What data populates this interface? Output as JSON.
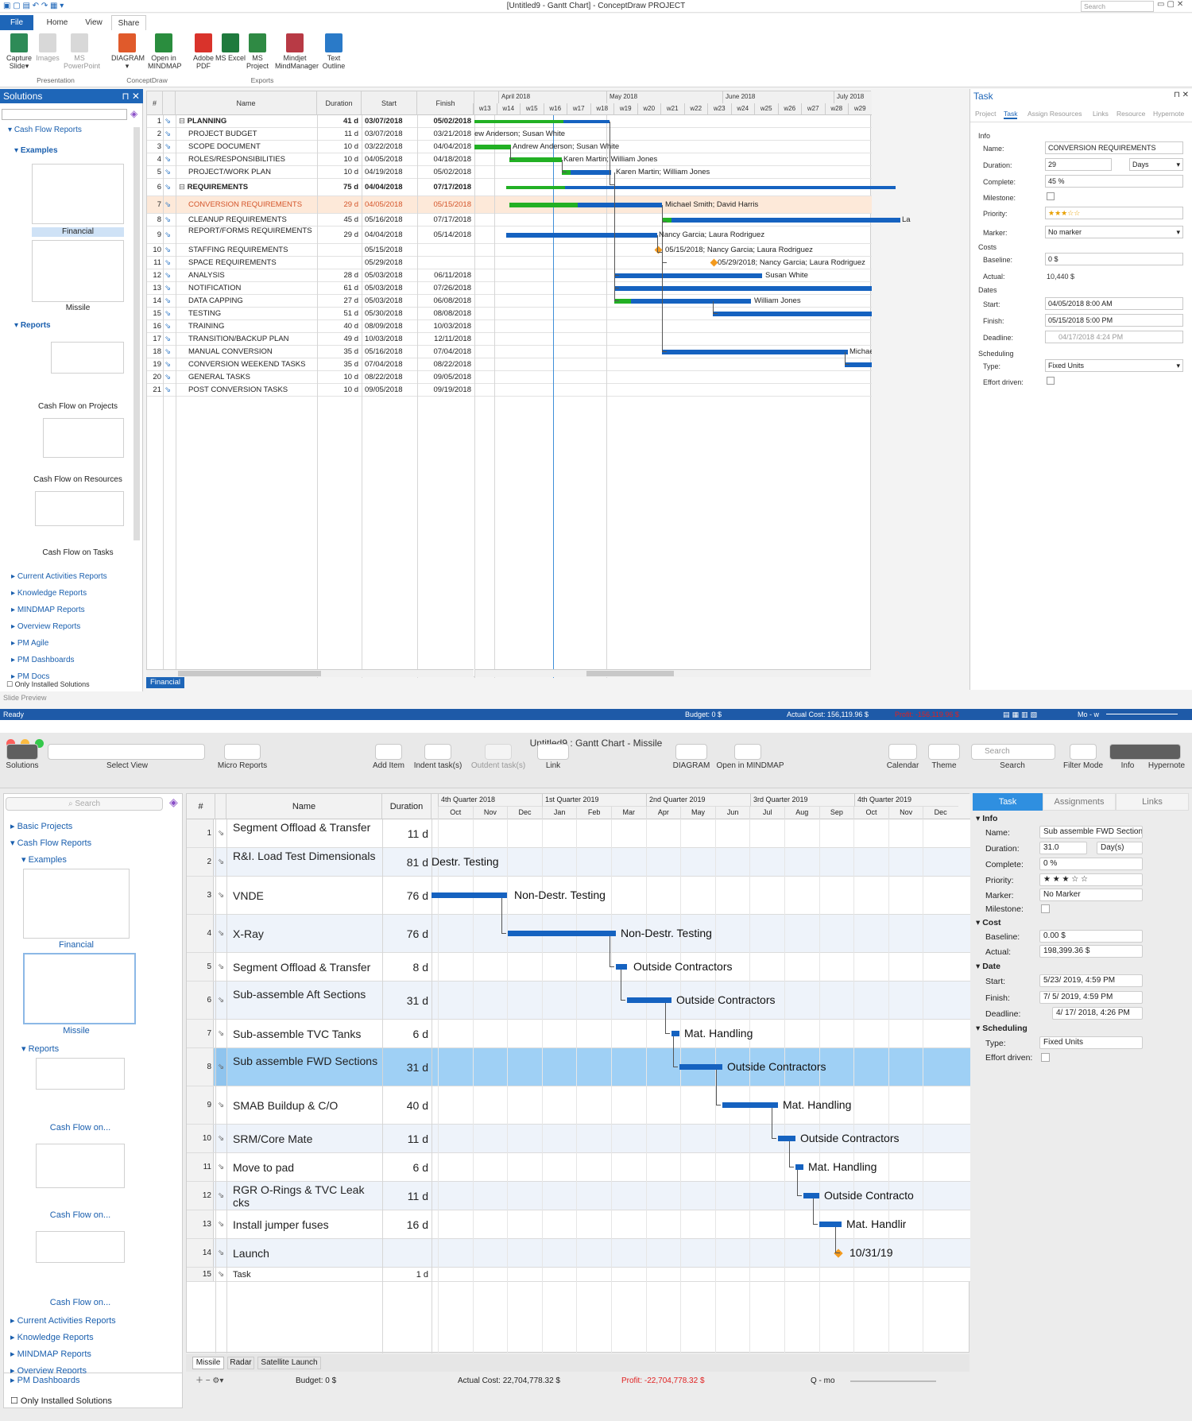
{
  "w1": {
    "title": "[Untitled9 - Gantt Chart] - ConceptDraw PROJECT",
    "search_placeholder": "Search",
    "tabs": [
      "File",
      "Home",
      "View",
      "Share"
    ],
    "ribbon": [
      {
        "label": "Capture Slide",
        "sub": "▾"
      },
      {
        "label": "Images"
      },
      {
        "label": "MS PowerPoint"
      },
      {
        "label": "DIAGRAM",
        "sub": "▾"
      },
      {
        "label": "Open in MINDMAP"
      },
      {
        "label": "Adobe PDF"
      },
      {
        "label": "MS Excel"
      },
      {
        "label": "MS Project"
      },
      {
        "label": "Mindjet MindManager"
      },
      {
        "label": "Text Outline"
      }
    ],
    "groups": [
      "Presentation",
      "ConceptDraw",
      "Exports"
    ],
    "solutions": {
      "title": "Solutions",
      "tree": [
        "Cash Flow Reports",
        "Examples",
        "Financial",
        "Missile",
        "Reports",
        "Cash Flow on Projects",
        "Cash Flow on Resources",
        "Cash Flow on Tasks",
        "Current Activities Reports",
        "Knowledge Reports",
        "MINDMAP Reports",
        "Overview Reports",
        "PM Agile",
        "PM Dashboards",
        "PM Docs"
      ],
      "only_installed": "Only Installed Solutions",
      "slide_preview": "Slide Preview"
    },
    "columns": [
      "#",
      "Name",
      "Duration",
      "Start",
      "Finish"
    ],
    "months": [
      "April 2018",
      "May 2018",
      "June 2018",
      "July 2018"
    ],
    "weeks": [
      "w13",
      "w14",
      "w15",
      "w16",
      "w17",
      "w18",
      "w19",
      "w20",
      "w21",
      "w22",
      "w23",
      "w24",
      "w25",
      "w26",
      "w27",
      "w28",
      "w29"
    ],
    "rows": [
      {
        "n": "1",
        "name": "PLANNING",
        "dur": "41 d",
        "start": "03/07/2018",
        "finish": "05/02/2018",
        "bold": true
      },
      {
        "n": "2",
        "name": "PROJECT BUDGET",
        "dur": "11 d",
        "start": "03/07/2018",
        "finish": "03/21/2018"
      },
      {
        "n": "3",
        "name": "SCOPE DOCUMENT",
        "dur": "10 d",
        "start": "03/22/2018",
        "finish": "04/04/2018"
      },
      {
        "n": "4",
        "name": "ROLES/RESPONSIBILITIES",
        "dur": "10 d",
        "start": "04/05/2018",
        "finish": "04/18/2018"
      },
      {
        "n": "5",
        "name": "PROJECT/WORK PLAN",
        "dur": "10 d",
        "start": "04/19/2018",
        "finish": "05/02/2018"
      },
      {
        "n": "6",
        "name": "REQUIREMENTS",
        "dur": "75 d",
        "start": "04/04/2018",
        "finish": "07/17/2018",
        "bold": true
      },
      {
        "n": "7",
        "name": "CONVERSION REQUIREMENTS",
        "dur": "29 d",
        "start": "04/05/2018",
        "finish": "05/15/2018"
      },
      {
        "n": "8",
        "name": "CLEANUP REQUIREMENTS",
        "dur": "45 d",
        "start": "05/16/2018",
        "finish": "07/17/2018"
      },
      {
        "n": "9",
        "name": "REPORT/FORMS REQUIREMENTS",
        "dur": "29 d",
        "start": "04/04/2018",
        "finish": "05/14/2018"
      },
      {
        "n": "10",
        "name": "STAFFING REQUIREMENTS",
        "dur": "",
        "start": "05/15/2018",
        "finish": ""
      },
      {
        "n": "11",
        "name": "SPACE REQUIREMENTS",
        "dur": "",
        "start": "05/29/2018",
        "finish": ""
      },
      {
        "n": "12",
        "name": "ANALYSIS",
        "dur": "28 d",
        "start": "05/03/2018",
        "finish": "06/11/2018"
      },
      {
        "n": "13",
        "name": "NOTIFICATION",
        "dur": "61 d",
        "start": "05/03/2018",
        "finish": "07/26/2018"
      },
      {
        "n": "14",
        "name": "DATA CAPPING",
        "dur": "27 d",
        "start": "05/03/2018",
        "finish": "06/08/2018"
      },
      {
        "n": "15",
        "name": "TESTING",
        "dur": "51 d",
        "start": "05/30/2018",
        "finish": "08/08/2018"
      },
      {
        "n": "16",
        "name": "TRAINING",
        "dur": "40 d",
        "start": "08/09/2018",
        "finish": "10/03/2018"
      },
      {
        "n": "17",
        "name": "TRANSITION/BACKUP PLAN",
        "dur": "49 d",
        "start": "10/03/2018",
        "finish": "12/11/2018"
      },
      {
        "n": "18",
        "name": "MANUAL CONVERSION",
        "dur": "35 d",
        "start": "05/16/2018",
        "finish": "07/04/2018"
      },
      {
        "n": "19",
        "name": "CONVERSION WEEKEND TASKS",
        "dur": "35 d",
        "start": "07/04/2018",
        "finish": "08/22/2018"
      },
      {
        "n": "20",
        "name": "GENERAL TASKS",
        "dur": "10 d",
        "start": "08/22/2018",
        "finish": "09/05/2018"
      },
      {
        "n": "21",
        "name": "POST CONVERSION TASKS",
        "dur": "10 d",
        "start": "09/05/2018",
        "finish": "09/19/2018"
      }
    ],
    "bar_labels": [
      "ew Anderson; Susan White",
      "Andrew Anderson; Susan White",
      "Karen Martin; William Jones",
      "Karen Martin; William Jones",
      "Michael Smith; David Harris",
      "La",
      "Nancy Garcia; Laura Rodriguez",
      "05/15/2018; Nancy Garcia; Laura Rodriguez",
      "05/29/2018; Nancy Garcia; Laura Rodriguez",
      "Susan White",
      "William Jones",
      "Michael Smith; Davi"
    ],
    "bottom_tab": "Financial",
    "task_panel": {
      "title": "Task",
      "tabs": [
        "Project",
        "Task",
        "Assign Resources",
        "Links",
        "Resource",
        "Hypernote"
      ],
      "info": "Info",
      "name_label": "Name:",
      "name": "CONVERSION REQUIREMENTS",
      "duration_label": "Duration:",
      "duration": "29",
      "duration_unit": "Days",
      "complete_label": "Complete:",
      "complete": "45 %",
      "milestone_label": "Milestone:",
      "priority_label": "Priority:",
      "priority": "★★★☆☆",
      "marker_label": "Marker:",
      "marker": "No marker",
      "costs": "Costs",
      "baseline_label": "Baseline:",
      "baseline": "0 $",
      "actual_label": "Actual:",
      "actual": "10,440 $",
      "dates": "Dates",
      "start_label": "Start:",
      "start": "04/05/2018    8:00 AM",
      "finish_label": "Finish:",
      "finish": "05/15/2018    5:00 PM",
      "deadline_label": "Deadline:",
      "deadline": "04/17/2018    4:24 PM",
      "scheduling": "Scheduling",
      "type_label": "Type:",
      "type": "Fixed Units",
      "effort_label": "Effort driven:"
    },
    "status": {
      "ready": "Ready",
      "budget": "Budget: 0 $",
      "actual": "Actual Cost: 156,119.96 $",
      "profit": "Profit: -156,119.96 $",
      "zoom": "Mo - w"
    }
  },
  "w2": {
    "title": "Untitled9 : Gantt Chart - Missile",
    "toolbar": [
      "Solutions",
      "Select View",
      "Micro Reports",
      "Add Item",
      "Indent task(s)",
      "Outdent task(s)",
      "Link",
      "DIAGRAM",
      "Open in MINDMAP",
      "Calendar",
      "Theme",
      "Search",
      "Filter Mode",
      "Info",
      "Hypernote"
    ],
    "search_placeholder": "Search",
    "sidebar": {
      "search_placeholder": "Search",
      "tree": [
        "Basic Projects",
        "Cash Flow Reports",
        "Examples",
        "Financial",
        "Missile",
        "Reports",
        "Cash Flow on...",
        "Cash Flow on...",
        "Cash Flow on...",
        "Current Activities Reports",
        "Knowledge Reports",
        "MINDMAP Reports",
        "Overview Reports",
        "PM Dashboards"
      ],
      "only_installed": "Only Installed Solutions"
    },
    "columns": [
      "#",
      "Name",
      "Duration"
    ],
    "quarters": [
      "4th Quarter 2018",
      "1st Quarter 2019",
      "2nd Quarter 2019",
      "3rd Quarter 2019",
      "4th Quarter 2019"
    ],
    "months": [
      "Oct",
      "Nov",
      "Dec",
      "Jan",
      "Feb",
      "Mar",
      "Apr",
      "May",
      "Jun",
      "Jul",
      "Aug",
      "Sep",
      "Oct",
      "Nov",
      "Dec"
    ],
    "rows": [
      {
        "n": "1",
        "name": "Segment Offload & Transfer",
        "dur": "11 d"
      },
      {
        "n": "2",
        "name": "R&I. Load Test Dimensionals",
        "dur": "81 d"
      },
      {
        "n": "3",
        "name": "VNDE",
        "dur": "76 d"
      },
      {
        "n": "4",
        "name": "X-Ray",
        "dur": "76 d"
      },
      {
        "n": "5",
        "name": "Segment Offload & Transfer",
        "dur": "8 d"
      },
      {
        "n": "6",
        "name": "Sub-assemble Aft Sections",
        "dur": "31 d"
      },
      {
        "n": "7",
        "name": "Sub-assemble TVC Tanks",
        "dur": "6 d"
      },
      {
        "n": "8",
        "name": "Sub assemble FWD Sections",
        "dur": "31 d"
      },
      {
        "n": "9",
        "name": "SMAB Buildup & C/O",
        "dur": "40 d"
      },
      {
        "n": "10",
        "name": "SRM/Core Mate",
        "dur": "11 d"
      },
      {
        "n": "11",
        "name": "Move to pad",
        "dur": "6 d"
      },
      {
        "n": "12",
        "name": "RGR O-Rings & TVC Leak cks",
        "dur": "11 d"
      },
      {
        "n": "13",
        "name": "Install jumper fuses",
        "dur": "16 d"
      },
      {
        "n": "14",
        "name": "Launch",
        "dur": ""
      },
      {
        "n": "15",
        "name": "Task",
        "dur": "1 d"
      }
    ],
    "bar_labels": [
      "Destr. Testing",
      "Non-Destr. Testing",
      "Non-Destr. Testing",
      "Outside Contractors",
      "Outside Contractors",
      "Mat. Handling",
      "Outside Contractors",
      "Mat. Handling",
      "Outside Contractors",
      "Mat. Handling",
      "Outside Contracto",
      "Mat. Handlir",
      "10/31/19"
    ],
    "sheet_tabs": [
      "Missile",
      "Radar",
      "Satellite Launch"
    ],
    "task_panel": {
      "tabs": [
        "Task",
        "Assignments",
        "Links"
      ],
      "info": "Info",
      "name_label": "Name:",
      "name": "Sub assemble FWD Sections",
      "duration_label": "Duration:",
      "duration": "31.0",
      "duration_unit": "Day(s)",
      "complete_label": "Complete:",
      "complete": "0 %",
      "priority_label": "Priority:",
      "priority": "★ ★ ★ ☆ ☆",
      "marker_label": "Marker:",
      "marker": "No Marker",
      "milestone_label": "Milestone:",
      "cost": "Cost",
      "baseline_label": "Baseline:",
      "baseline": "0.00 $",
      "actual_label": "Actual:",
      "actual": "198,399.36 $",
      "date": "Date",
      "start_label": "Start:",
      "start": "5/23/ 2019,   4:59 PM",
      "finish_label": "Finish:",
      "finish": "7/  5/ 2019,   4:59 PM",
      "deadline_label": "Deadline:",
      "deadline": "4/ 17/ 2018,   4:26 PM",
      "scheduling": "Scheduling",
      "type_label": "Type:",
      "type": "Fixed Units",
      "effort_label": "Effort driven:"
    },
    "status": {
      "budget": "Budget: 0 $",
      "actual": "Actual Cost: 22,704,778.32 $",
      "profit": "Profit: -22,704,778.32 $",
      "zoom": "Q - mo"
    }
  },
  "colors": {
    "accent": "#1e66b8",
    "bar": "#1562c0",
    "progress": "#22b024",
    "selected_row": "#fde9d9",
    "selected_row2": "#9fd0f5",
    "profit": "#e02020"
  }
}
